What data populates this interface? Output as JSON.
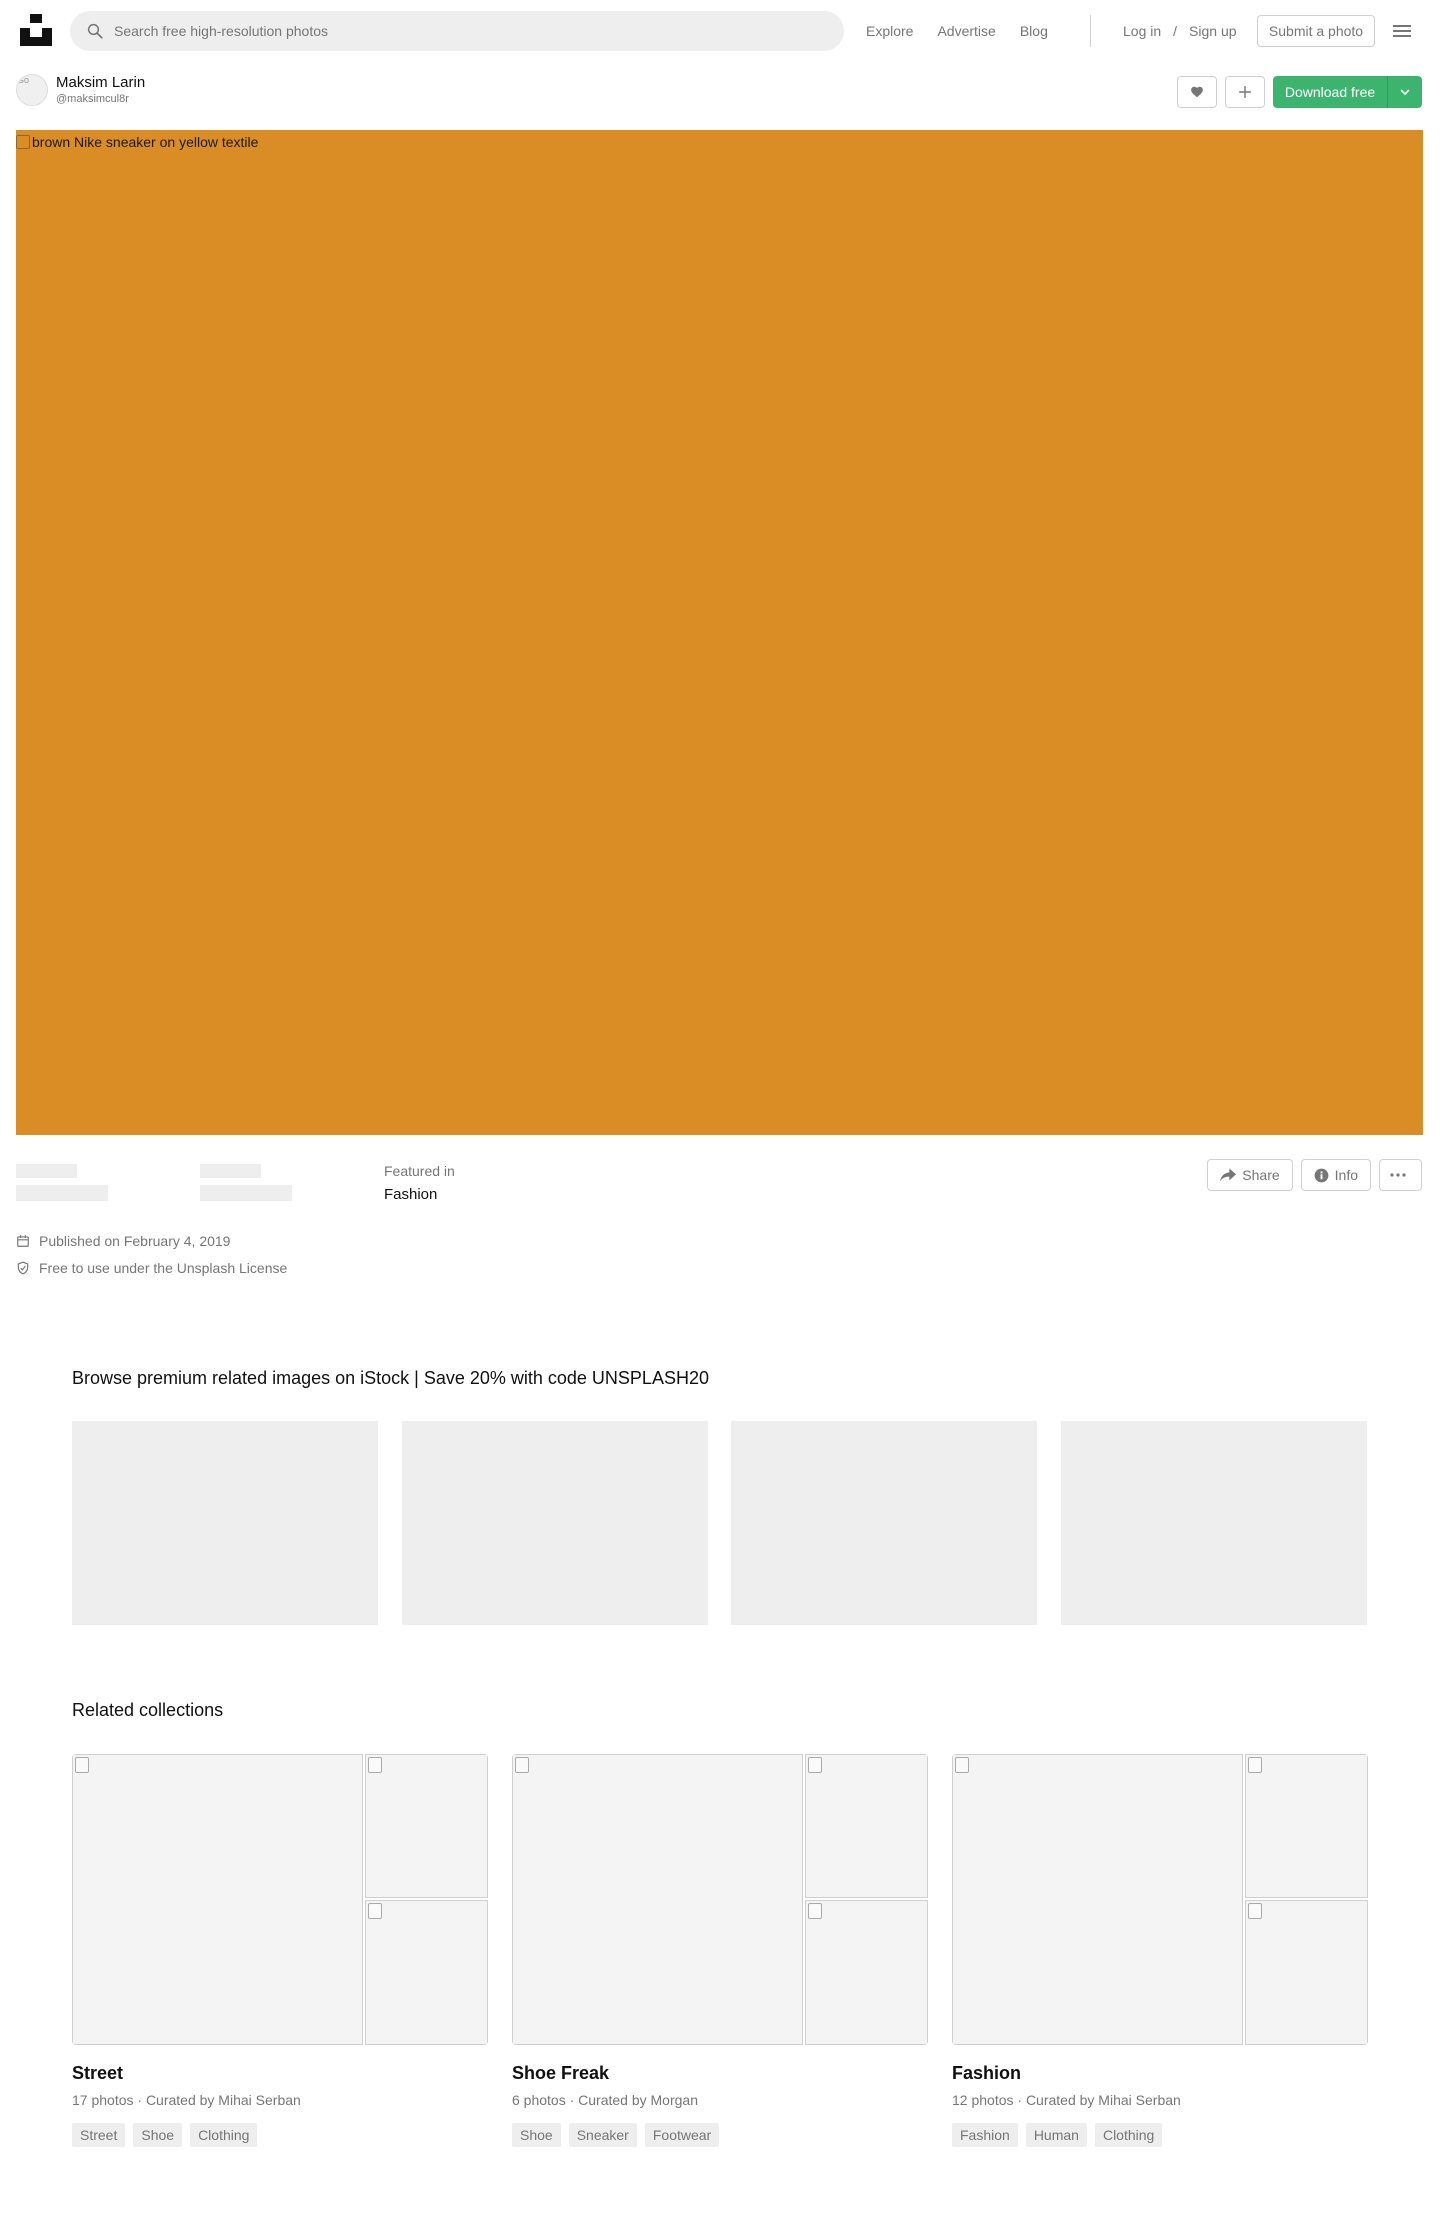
{
  "nav": {
    "search_placeholder": "Search free high-resolution photos",
    "links": [
      "Explore",
      "Advertise",
      "Blog"
    ],
    "login": "Log in",
    "slash": "/",
    "signup": "Sign up",
    "submit": "Submit a photo"
  },
  "author": {
    "name": "Maksim Larin",
    "handle": "@maksimcul8r",
    "avatar_alt": "Go"
  },
  "actions": {
    "download": "Download free"
  },
  "photo": {
    "alt": "brown Nike sneaker on yellow textile",
    "color": "#d98d24"
  },
  "meta": {
    "featured_label": "Featured in",
    "featured_value": "Fashion",
    "share": "Share",
    "info": "Info",
    "published": "Published on February 4, 2019",
    "license": "Free to use under the Unsplash License"
  },
  "istock": {
    "title": "Browse premium related images on iStock | Save 20% with code UNSPLASH20"
  },
  "collections": {
    "title": "Related collections",
    "items": [
      {
        "name": "Street",
        "meta": "17 photos · Curated by Mihai Serban",
        "tags": [
          "Street",
          "Shoe",
          "Clothing"
        ]
      },
      {
        "name": "Shoe Freak",
        "meta": "6 photos · Curated by Morgan",
        "tags": [
          "Shoe",
          "Sneaker",
          "Footwear"
        ]
      },
      {
        "name": "Fashion",
        "meta": "12 photos · Curated by Mihai Serban",
        "tags": [
          "Fashion",
          "Human",
          "Clothing"
        ]
      }
    ]
  },
  "colors": {
    "accent": "#3cb46e",
    "muted_text": "#767676"
  }
}
